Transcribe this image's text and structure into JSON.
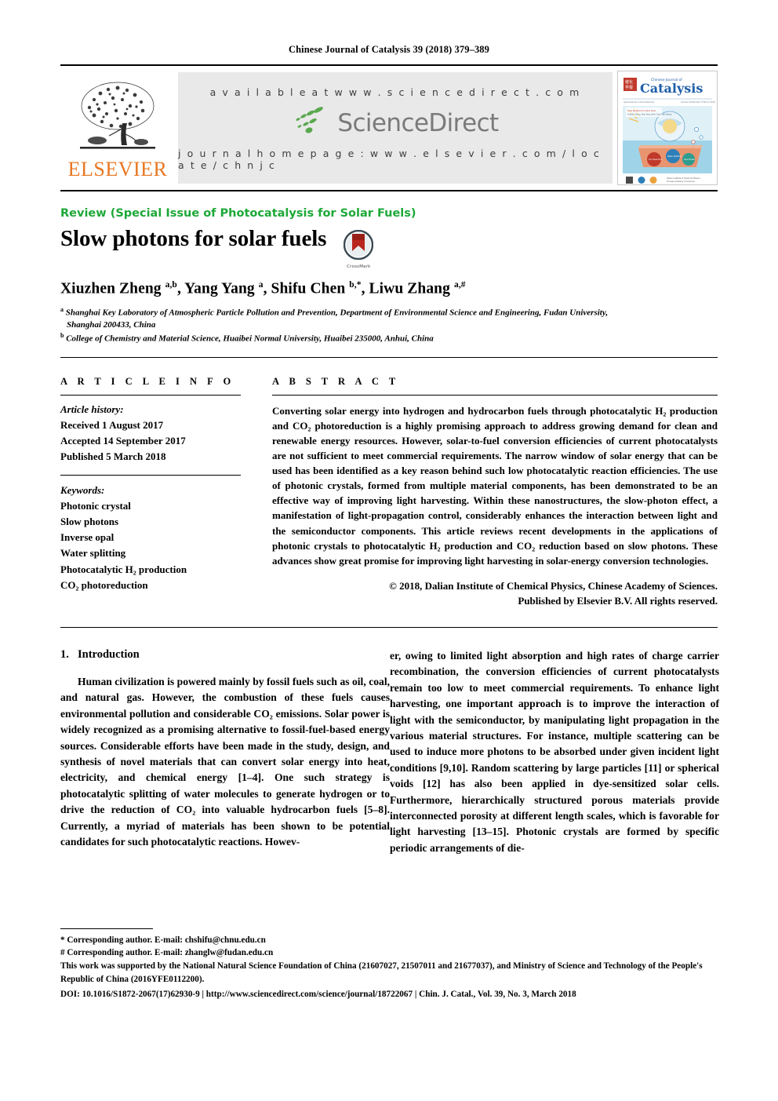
{
  "running_head": "Chinese Journal of Catalysis 39 (2018) 379–389",
  "masthead": {
    "publisher_name": "ELSEVIER",
    "available_at": "a v a i l a b l e   a t   w w w . s c i e n c e d i r e c t . c o m",
    "sciencedirect_word": "ScienceDirect",
    "journal_homepage": "j o u r n a l   h o m e p a g e :   w w w . e l s e v i e r . c o m / l o c a t e / c h n j c",
    "cover_title_small": "Chinese Journal of",
    "cover_title_main": "Catalysis"
  },
  "article": {
    "section_label": "Review (Special Issue of Photocatalysis for Solar Fuels)",
    "title": "Slow photons for solar fuels",
    "crossmark_label": "CrossMark",
    "authors_html": "Xiuzhen Zheng <sup>a,b</sup>, Yang Yang <sup>a</sup>, Shifu Chen <sup>b,*</sup>, Liwu Zhang <sup>a,#</sup>",
    "affiliation_a_line1": "Shanghai Key Laboratory of Atmospheric Particle Pollution and Prevention, Department of Environmental Science and Engineering, Fudan University,",
    "affiliation_a_line2": "Shanghai 200433, China",
    "affiliation_b": "College of Chemistry and Material Science, Huaibei Normal University, Huaibei 235000, Anhui, China"
  },
  "article_info": {
    "heading": "A R T I C L E   I N F O",
    "history_label": "Article history:",
    "received": "Received 1 August 2017",
    "accepted": "Accepted 14 September 2017",
    "published": "Published 5 March 2018",
    "keywords_label": "Keywords:",
    "keywords": [
      "Photonic crystal",
      "Slow photons",
      "Inverse opal",
      "Water splitting",
      "Photocatalytic H₂ production",
      "CO₂ photoreduction"
    ]
  },
  "abstract": {
    "heading": "A B S T R A C T",
    "text": "Converting solar energy into hydrogen and hydrocarbon fuels through photocatalytic H₂ production and CO₂ photoreduction is a highly promising approach to address growing demand for clean and renewable energy resources. However, solar-to-fuel conversion efficiencies of current photocatalysts are not sufficient to meet commercial requirements. The narrow window of solar energy that can be used has been identified as a key reason behind such low photocatalytic reaction efficiencies. The use of photonic crystals, formed from multiple material components, has been demonstrated to be an effective way of improving light harvesting. Within these nanostructures, the slow-photon effect, a manifestation of light-propagation control, considerably enhances the interaction between light and the semiconductor components. This article reviews recent developments in the applications of photonic crystals to photocatalytic H₂ production and CO₂ reduction based on slow photons. These advances show great promise for improving light harvesting in solar-energy conversion technologies.",
    "copyright_line1": "© 2018, Dalian Institute of Chemical Physics, Chinese Academy of Sciences.",
    "copyright_line2": "Published by Elsevier B.V. All rights reserved."
  },
  "body": {
    "section_number": "1.",
    "section_title": "Introduction",
    "left_paragraph": "Human civilization is powered mainly by fossil fuels such as oil, coal, and natural gas. However, the combustion of these fuels causes environmental pollution and considerable CO₂ emissions. Solar power is widely recognized as a promising alternative to fossil-fuel-based energy sources. Considerable efforts have been made in the study, design, and synthesis of novel materials that can convert solar energy into heat, electricity, and chemical energy [1–4]. One such strategy is photocatalytic splitting of water molecules to generate hydrogen or to drive the reduction of CO₂ into valuable hydrocarbon fuels [5–8]. Currently, a myriad of materials has been shown to be potential candidates for such photocatalytic reactions. Howev-",
    "right_paragraph": "er, owing to limited light absorption and high rates of charge carrier recombination, the conversion efficiencies of current photocatalysts remain too low to meet commercial requirements. To enhance light harvesting, one important approach is to improve the interaction of light with the semiconductor, by manipulating light propagation in the various material structures. For instance, multiple scattering can be used to induce more photons to be absorbed under given incident light conditions [9,10]. Random scattering by large particles [11] or spherical voids [12] has also been applied in dye-sensitized solar cells. Furthermore, hierarchically structured porous materials provide interconnected porosity at different length scales, which is favorable for light harvesting [13–15]. Photonic crystals are formed by specific periodic arrangements of die-"
  },
  "footnotes": {
    "corresponding_1": "* Corresponding author. E-mail: chshifu@chnu.edu.cn",
    "corresponding_2": "# Corresponding author. E-mail: zhanglw@fudan.edu.cn",
    "funding": "This work was supported by the National Natural Science Foundation of China (21607027, 21507011 and 21677037), and Ministry of Science and Technology of the People's Republic of China (2016YFE0112200).",
    "doi_line": "DOI: 10.1016/S1872-2067(17)62930-9 | http://www.sciencedirect.com/science/journal/18722067 | Chin. J. Catal., Vol. 39, No. 3, March 2018"
  },
  "colors": {
    "review_green": "#1da838",
    "elsevier_orange": "#E87722",
    "sciencedirect_gray": "#7a7a7a",
    "band_background": "#e9e9e9"
  }
}
